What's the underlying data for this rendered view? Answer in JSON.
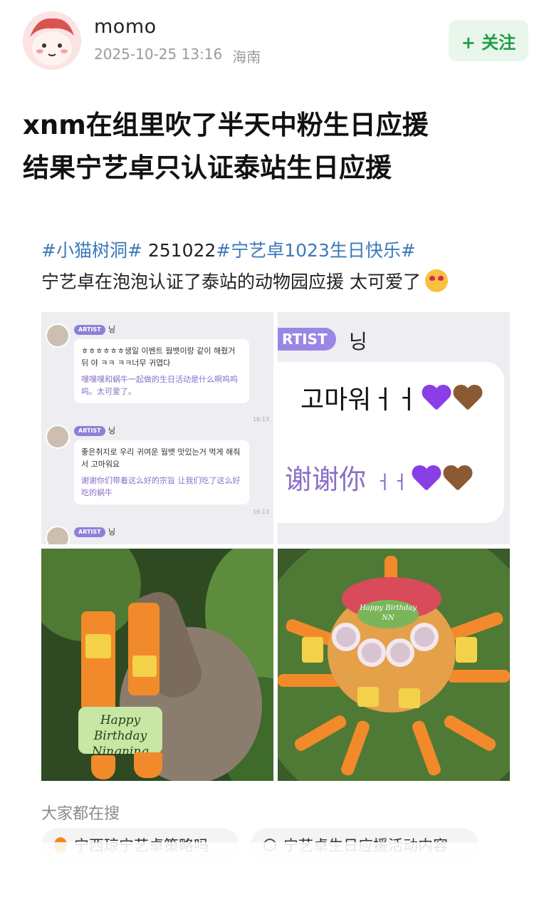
{
  "author": {
    "name": "momo",
    "time": "2025-10-25 13:16",
    "location": "海南"
  },
  "follow_button": {
    "label": "+ 关注"
  },
  "title_lines": [
    "xnm在组里吹了半天中粉生日应援",
    "结果宁艺卓只认证泰站生日应援"
  ],
  "post": {
    "tags": [
      "#小猫树洞#",
      "#宁艺卓1023生日快乐#"
    ],
    "date_code": "251022",
    "text": "宁艺卓在泡泡认证了泰站的动物园应援 太可爱了"
  },
  "images": {
    "chat_small": {
      "badge": "ARTIST",
      "nick": "닝",
      "messages": [
        {
          "ko": "ㅎㅎㅎㅎㅎㅎ생일 이벤트 웜뱃이랑 같이 해줬거뒤 야 ㅋㅋ ㅋㅋ너무 귀엽다",
          "zh": "嘿嘿嘿和蜗牛一起做的生日活动是什么啊呜呜呜。太可爱了。",
          "time": "16:13"
        },
        {
          "ko": "좋은취지로 우리 귀여운 웜뱃 맛있는거 먹게 해줘서 고마워요",
          "zh": "谢谢你们带着这么好的宗旨 让我们吃了这么好吃的蜗牛",
          "time": "16:13"
        }
      ]
    },
    "chat_zoom": {
      "badge": "RTIST",
      "nick": "닝",
      "ko": "고마워ㅓㅓ",
      "zh": "谢谢你",
      "zh_suffix": "ㅓㅓ"
    },
    "sloth_sign": {
      "line1": "Happy Birthday",
      "line2": "Ningning"
    },
    "cake_sign": {
      "line1": "Happy Birthday",
      "line2": "NN"
    }
  },
  "search": {
    "heading": "大家都在搜",
    "chips": [
      "宁西琼宁艺卓策略吗",
      "宁艺卓生日应援活动内容"
    ]
  },
  "colors": {
    "follow_green": "#1f9d44",
    "tag_blue": "#3c78b8",
    "heart_purple": "#8a3ee6",
    "heart_brown": "#8a5a35"
  }
}
